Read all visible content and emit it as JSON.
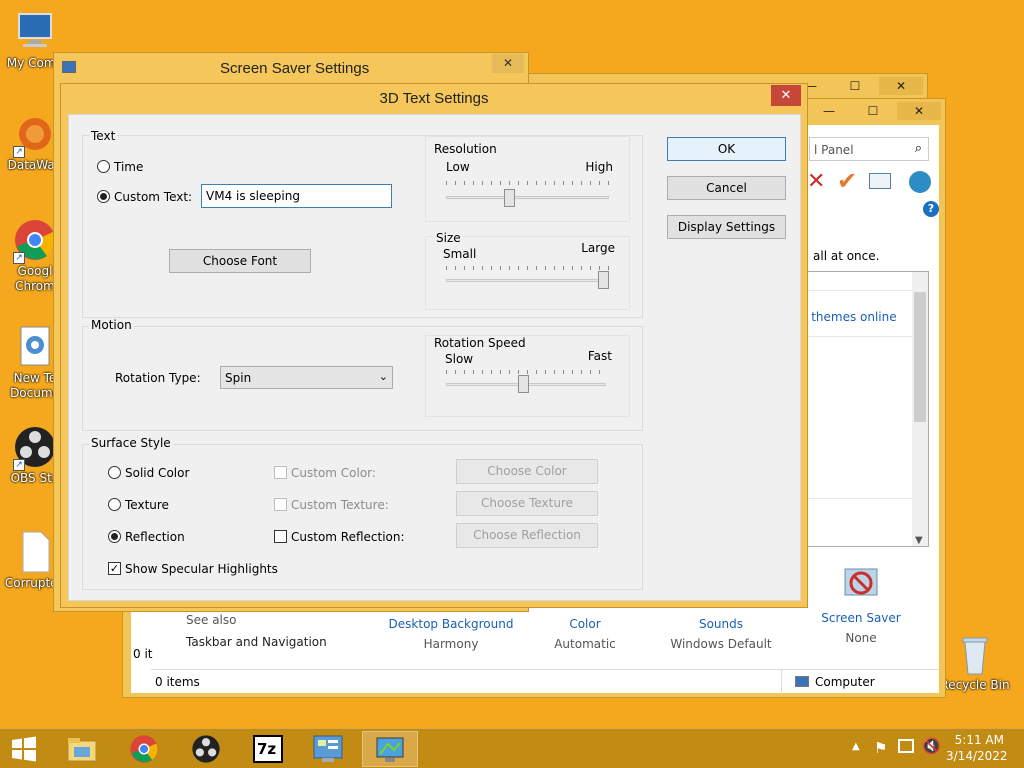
{
  "desktop_icons": [
    {
      "label": "My Comp",
      "icon": "computer-icon"
    },
    {
      "label": "DataWag",
      "icon": "datawag-icon"
    },
    {
      "label": "Google Chrome",
      "line1": "Googl",
      "line2": "Chrom",
      "icon": "chrome-icon"
    },
    {
      "label": "New Text Document",
      "line1": "New Te",
      "line2": "Docume",
      "icon": "text-document-icon"
    },
    {
      "label": "OBS Stu",
      "icon": "obs-icon"
    },
    {
      "label": "Corrupted",
      "icon": "file-icon"
    },
    {
      "label": "Recycle Bin",
      "icon": "recycle-bin-icon"
    }
  ],
  "screensaver_window": {
    "title": "Screen Saver Settings",
    "close": "✕"
  },
  "control_panel": {
    "search_placeholder": "l Panel",
    "apply_text": "all at once.",
    "themes_link": "e themes online",
    "see_also": "See also",
    "taskbar_nav": "Taskbar and Navigation",
    "items_status": "0 items",
    "items_partial": "0 it",
    "computer_label": "Computer",
    "bottom_items": [
      {
        "label": "Desktop Background",
        "sub": "Harmony"
      },
      {
        "label": "Color",
        "sub": "Automatic"
      },
      {
        "label": "Sounds",
        "sub": "Windows Default"
      },
      {
        "label": "Screen Saver",
        "sub": "None"
      }
    ],
    "help": "?"
  },
  "dialog": {
    "title": "3D Text Settings",
    "close": "✕",
    "text_group": {
      "label": "Text",
      "time_label": "Time",
      "custom_text_label": "Custom Text:",
      "custom_text_value": "VM4 is sleeping",
      "choose_font": "Choose Font",
      "resolution": {
        "label": "Resolution",
        "low": "Low",
        "high": "High",
        "value_fraction": 0.38
      },
      "size": {
        "label": "Size",
        "small": "Small",
        "large": "Large",
        "value_fraction": 1.0
      }
    },
    "motion_group": {
      "label": "Motion",
      "rotation_type_label": "Rotation Type:",
      "rotation_type_value": "Spin",
      "rotation_speed": {
        "label": "Rotation Speed",
        "slow": "Slow",
        "fast": "Fast",
        "value_fraction": 0.48
      }
    },
    "surface_group": {
      "label": "Surface Style",
      "solid_color": "Solid Color",
      "texture": "Texture",
      "reflection": "Reflection",
      "custom_color": "Custom Color:",
      "custom_texture": "Custom Texture:",
      "custom_reflection": "Custom Reflection:",
      "choose_color": "Choose Color",
      "choose_texture": "Choose Texture",
      "choose_reflection": "Choose Reflection",
      "show_specular": "Show Specular Highlights",
      "selected": "Reflection",
      "specular_checked": true
    },
    "buttons": {
      "ok": "OK",
      "cancel": "Cancel",
      "display_settings": "Display Settings"
    }
  },
  "taskbar": {
    "items": [
      {
        "icon": "windows-start-icon"
      },
      {
        "icon": "file-explorer-icon"
      },
      {
        "icon": "chrome-icon"
      },
      {
        "icon": "obs-icon"
      },
      {
        "icon": "7zip-icon",
        "text": "7z"
      },
      {
        "icon": "control-panel-icon"
      },
      {
        "icon": "screensaver-icon"
      }
    ],
    "time": "5:11 AM",
    "date": "3/14/2022"
  },
  "colors": {
    "desktop": "#f5a81e",
    "window_frame": "#f5c75a",
    "close_red": "#c7463a",
    "link": "#1a5fb4"
  }
}
